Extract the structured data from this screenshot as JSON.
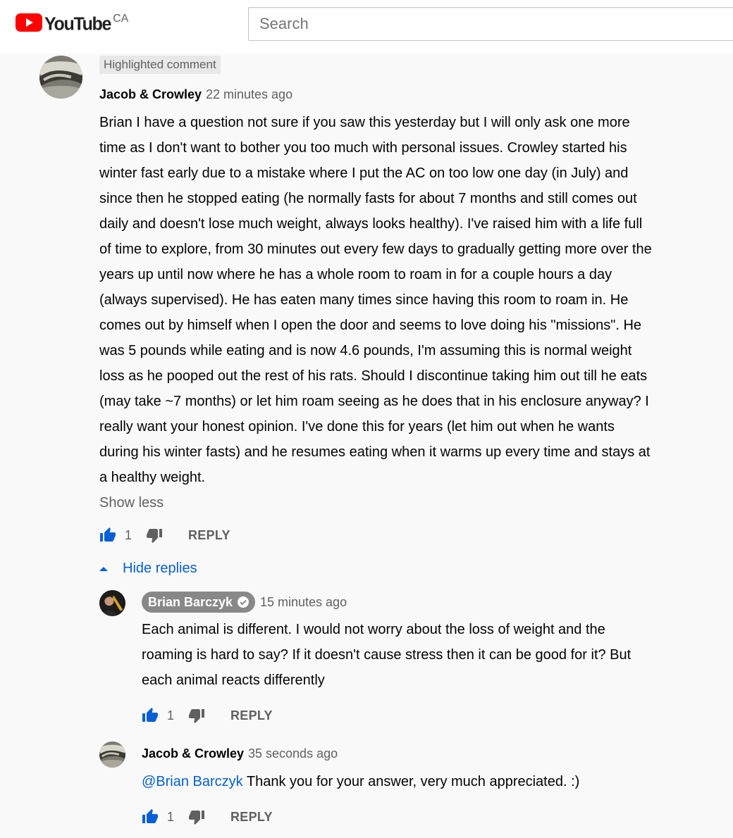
{
  "header": {
    "logo_text": "YouTube",
    "country": "CA",
    "search_placeholder": "Search"
  },
  "comment": {
    "highlight_label": "Highlighted comment",
    "author": "Jacob & Crowley",
    "time": "22 minutes ago",
    "lines": [
      "Brian I have a question not sure if you saw this yesterday but I will only ask one more",
      "time as I don't want to bother you too much with personal issues. Crowley started his",
      "winter fast early due to a mistake where I put the AC on too low one day (in July) and",
      "since then he stopped eating (he normally fasts for about 7 months and still comes out",
      "daily and doesn't lose much weight, always looks healthy). I've raised him with a life full",
      "of time to explore, from 30 minutes out every few days to gradually getting more over the",
      "years up until now where he has a whole room to roam in for a couple hours a day",
      "(always supervised). He has eaten many times since having this room to roam in. He",
      "comes out by himself when I open the door and seems to love doing his \"missions\". He",
      "was 5 pounds while eating and is now 4.6 pounds, I'm assuming this is normal weight",
      "loss as he pooped out the rest of his rats. Should I discontinue taking him out till he eats",
      "(may take ~7 months) or let him roam seeing as he does that in his enclosure anyway? I",
      "really want your honest opinion. I've done this for years (let him out when he wants",
      "during his winter fasts) and he resumes eating when it warms up every time and stays at",
      "a healthy weight."
    ],
    "show_less": "Show less",
    "likes": "1",
    "reply_label": "REPLY",
    "hide_replies": "Hide replies"
  },
  "replies": [
    {
      "author": "Brian Barczyk",
      "is_creator": true,
      "time": "15 minutes ago",
      "lines": [
        "Each animal is different. I would not worry about the loss of weight and the",
        "roaming is hard to say? If it doesn't cause stress then it can be good for it? But",
        "each animal reacts differently"
      ],
      "likes": "1",
      "reply_label": "REPLY"
    },
    {
      "author": "Jacob & Crowley",
      "is_creator": false,
      "time": "35 seconds ago",
      "mention": "@Brian Barczyk",
      "text": " Thank you for your answer, very much appreciated. :)",
      "likes": "1",
      "reply_label": "REPLY"
    }
  ],
  "colors": {
    "brand_red": "#ff0000",
    "link_blue": "#065fd4",
    "like_active": "#065fd4",
    "muted": "#606060",
    "creator_badge_bg": "#888888"
  },
  "icons": {
    "logo": "youtube-play-icon",
    "like": "thumbs-up-icon",
    "dislike": "thumbs-down-icon",
    "caret": "caret-up-icon",
    "verified": "verified-check-icon"
  }
}
